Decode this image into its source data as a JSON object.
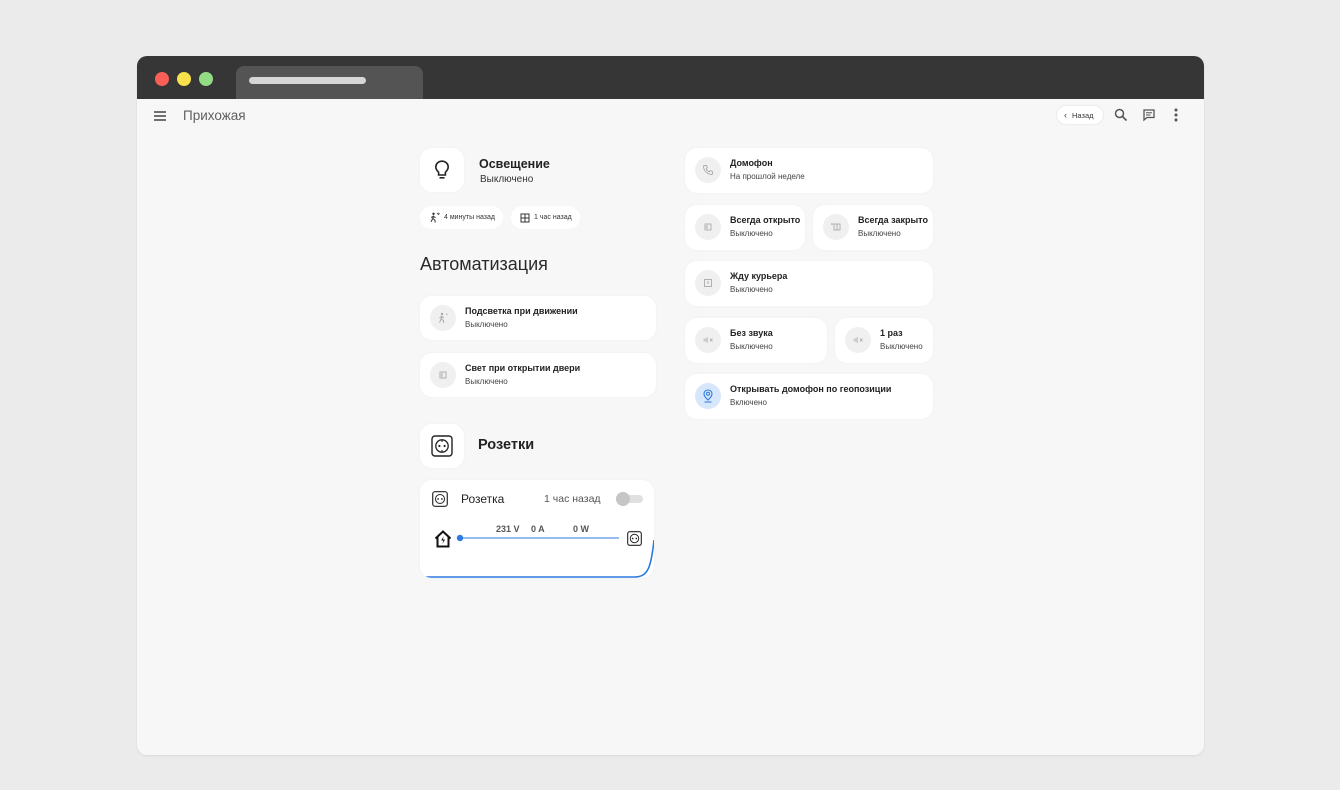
{
  "page": {
    "title": "Прихожая"
  },
  "appbar": {
    "back_label": "Назад"
  },
  "lighting": {
    "title": "Освещение",
    "status": "Выключено"
  },
  "chips": [
    {
      "label": "4 минуты назад",
      "icon": "motion-icon"
    },
    {
      "label": "1 час назад",
      "icon": "window-icon"
    }
  ],
  "automation": {
    "title": "Автоматизация",
    "items": [
      {
        "title": "Подсветка при движении",
        "status": "Выключено"
      },
      {
        "title": "Свет при открытии двери",
        "status": "Выключено"
      }
    ]
  },
  "sockets": {
    "title": "Розетки",
    "socket": {
      "name": "Розетка",
      "time": "1 час назад",
      "voltage": "231 V",
      "current": "0 A",
      "power": "0 W"
    }
  },
  "intercom": {
    "main": {
      "title": "Домофон",
      "status": "На прошлой неделе"
    },
    "always_open": {
      "title": "Всегда открыто",
      "status": "Выключено"
    },
    "always_closed": {
      "title": "Всегда закрыто",
      "status": "Выключено"
    },
    "courier": {
      "title": "Жду курьера",
      "status": "Выключено"
    },
    "mute": {
      "title": "Без звука",
      "status": "Выключено"
    },
    "once": {
      "title": "1 раз",
      "status": "Выключено"
    },
    "geo": {
      "title": "Открывать домофон по геопозиции",
      "status": "Включено"
    }
  },
  "colors": {
    "accent": "#2d7ae0",
    "titlebar": "#363636",
    "background": "#f7f7f7"
  }
}
